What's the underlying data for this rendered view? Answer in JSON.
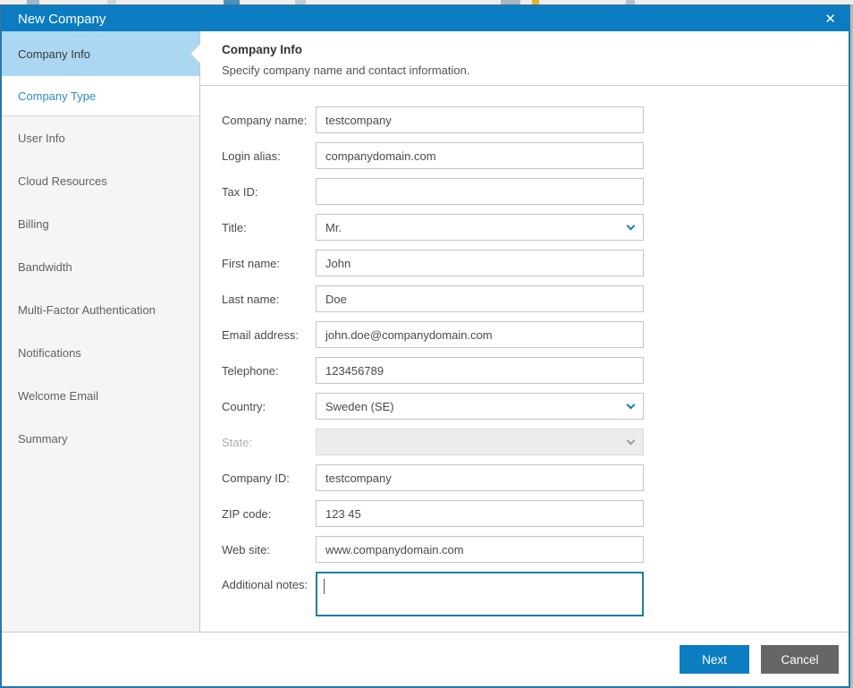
{
  "window": {
    "title": "New Company",
    "close_icon": "✕"
  },
  "sidebar": {
    "items": [
      {
        "label": "Company Info",
        "state": "active"
      },
      {
        "label": "Company Type",
        "state": "enabled"
      },
      {
        "label": "User Info",
        "state": "disabled"
      },
      {
        "label": "Cloud Resources",
        "state": "disabled"
      },
      {
        "label": "Billing",
        "state": "disabled"
      },
      {
        "label": "Bandwidth",
        "state": "disabled"
      },
      {
        "label": "Multi-Factor Authentication",
        "state": "disabled"
      },
      {
        "label": "Notifications",
        "state": "disabled"
      },
      {
        "label": "Welcome Email",
        "state": "disabled"
      },
      {
        "label": "Summary",
        "state": "disabled"
      }
    ]
  },
  "content": {
    "heading": "Company Info",
    "subtitle": "Specify company name and contact information.",
    "fields": [
      {
        "label": "Company name:",
        "value": "testcompany",
        "type": "text"
      },
      {
        "label": "Login alias:",
        "value": "companydomain.com",
        "type": "text"
      },
      {
        "label": "Tax ID:",
        "value": "",
        "type": "text"
      },
      {
        "label": "Title:",
        "value": "Mr.",
        "type": "select"
      },
      {
        "label": "First name:",
        "value": "John",
        "type": "text"
      },
      {
        "label": "Last name:",
        "value": "Doe",
        "type": "text"
      },
      {
        "label": "Email address:",
        "value": "john.doe@companydomain.com",
        "type": "text"
      },
      {
        "label": "Telephone:",
        "value": "123456789",
        "type": "text"
      },
      {
        "label": "Country:",
        "value": "Sweden (SE)",
        "type": "select"
      },
      {
        "label": "State:",
        "value": "",
        "type": "select",
        "disabled": true
      },
      {
        "label": "Company ID:",
        "value": "testcompany",
        "type": "text"
      },
      {
        "label": "ZIP code:",
        "value": "123 45",
        "type": "text"
      },
      {
        "label": "Web site:",
        "value": "www.companydomain.com",
        "type": "text"
      },
      {
        "label": "Additional notes:",
        "value": "",
        "type": "textarea",
        "focused": true
      }
    ]
  },
  "footer": {
    "next_label": "Next",
    "cancel_label": "Cancel"
  },
  "colors": {
    "titlebar_blue": "#0b7cc1",
    "accent_blue": "#0d7dc1",
    "active_step_bg": "#abd7f3",
    "link_blue": "#2b8dc6",
    "cancel_gray": "#666667",
    "focus_border": "#1e7ca9",
    "dialog_border": "#2578aa"
  }
}
